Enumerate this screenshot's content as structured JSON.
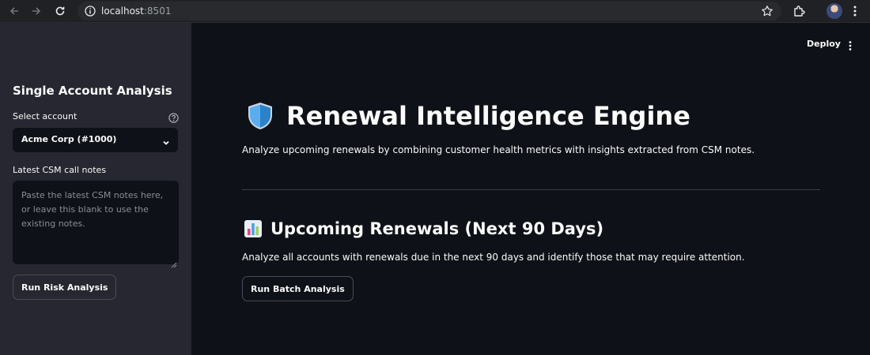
{
  "browser": {
    "url_host": "localhost",
    "url_port": ":8501",
    "icons": {
      "back": "arrow-left-icon",
      "forward": "arrow-right-icon",
      "reload": "reload-icon",
      "info": "info-icon",
      "bookmark": "star-icon",
      "extensions": "puzzle-icon",
      "profile": "avatar",
      "menu": "kebab-menu-icon"
    }
  },
  "sidebar": {
    "title": "Single Account Analysis",
    "account_label": "Select account",
    "account_value": "Acme Corp (#1000)",
    "notes_label": "Latest CSM call notes",
    "notes_placeholder": "Paste the latest CSM notes here, or leave this blank to use the existing notes.",
    "notes_value": "",
    "run_button": "Run Risk Analysis"
  },
  "header": {
    "deploy_label": "Deploy"
  },
  "main": {
    "title": "Renewal Intelligence Engine",
    "title_icon": "shield-icon",
    "description": "Analyze upcoming renewals by combining customer health metrics with insights extracted from CSM notes.",
    "section_title": "Upcoming Renewals (Next 90 Days)",
    "section_icon": "bar-chart-icon",
    "section_description": "Analyze all accounts with renewals due in the next 90 days and identify those that may require attention.",
    "batch_button": "Run Batch Analysis"
  },
  "colors": {
    "app_background": "#0e1117",
    "sidebar_background": "#262730",
    "text": "#fafafa",
    "browser_chrome": "#202124"
  }
}
